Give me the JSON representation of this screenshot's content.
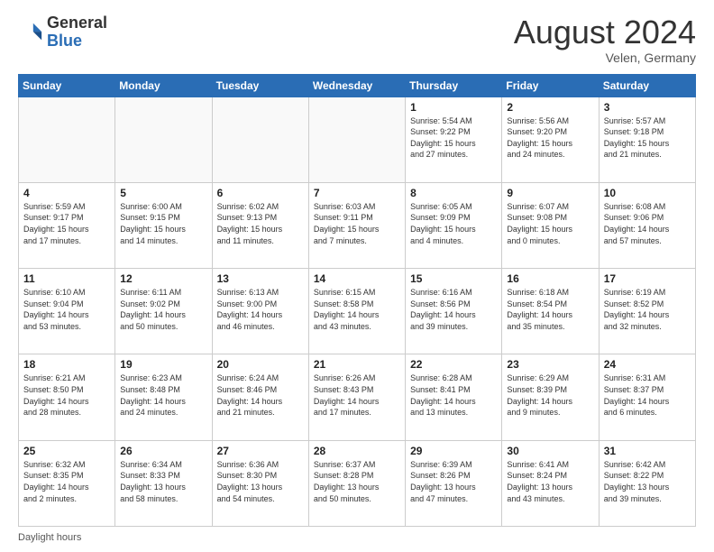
{
  "header": {
    "logo_general": "General",
    "logo_blue": "Blue",
    "month_title": "August 2024",
    "location": "Velen, Germany"
  },
  "footer": {
    "label": "Daylight hours"
  },
  "days_of_week": [
    "Sunday",
    "Monday",
    "Tuesday",
    "Wednesday",
    "Thursday",
    "Friday",
    "Saturday"
  ],
  "weeks": [
    [
      {
        "day": "",
        "info": ""
      },
      {
        "day": "",
        "info": ""
      },
      {
        "day": "",
        "info": ""
      },
      {
        "day": "",
        "info": ""
      },
      {
        "day": "1",
        "info": "Sunrise: 5:54 AM\nSunset: 9:22 PM\nDaylight: 15 hours\nand 27 minutes."
      },
      {
        "day": "2",
        "info": "Sunrise: 5:56 AM\nSunset: 9:20 PM\nDaylight: 15 hours\nand 24 minutes."
      },
      {
        "day": "3",
        "info": "Sunrise: 5:57 AM\nSunset: 9:18 PM\nDaylight: 15 hours\nand 21 minutes."
      }
    ],
    [
      {
        "day": "4",
        "info": "Sunrise: 5:59 AM\nSunset: 9:17 PM\nDaylight: 15 hours\nand 17 minutes."
      },
      {
        "day": "5",
        "info": "Sunrise: 6:00 AM\nSunset: 9:15 PM\nDaylight: 15 hours\nand 14 minutes."
      },
      {
        "day": "6",
        "info": "Sunrise: 6:02 AM\nSunset: 9:13 PM\nDaylight: 15 hours\nand 11 minutes."
      },
      {
        "day": "7",
        "info": "Sunrise: 6:03 AM\nSunset: 9:11 PM\nDaylight: 15 hours\nand 7 minutes."
      },
      {
        "day": "8",
        "info": "Sunrise: 6:05 AM\nSunset: 9:09 PM\nDaylight: 15 hours\nand 4 minutes."
      },
      {
        "day": "9",
        "info": "Sunrise: 6:07 AM\nSunset: 9:08 PM\nDaylight: 15 hours\nand 0 minutes."
      },
      {
        "day": "10",
        "info": "Sunrise: 6:08 AM\nSunset: 9:06 PM\nDaylight: 14 hours\nand 57 minutes."
      }
    ],
    [
      {
        "day": "11",
        "info": "Sunrise: 6:10 AM\nSunset: 9:04 PM\nDaylight: 14 hours\nand 53 minutes."
      },
      {
        "day": "12",
        "info": "Sunrise: 6:11 AM\nSunset: 9:02 PM\nDaylight: 14 hours\nand 50 minutes."
      },
      {
        "day": "13",
        "info": "Sunrise: 6:13 AM\nSunset: 9:00 PM\nDaylight: 14 hours\nand 46 minutes."
      },
      {
        "day": "14",
        "info": "Sunrise: 6:15 AM\nSunset: 8:58 PM\nDaylight: 14 hours\nand 43 minutes."
      },
      {
        "day": "15",
        "info": "Sunrise: 6:16 AM\nSunset: 8:56 PM\nDaylight: 14 hours\nand 39 minutes."
      },
      {
        "day": "16",
        "info": "Sunrise: 6:18 AM\nSunset: 8:54 PM\nDaylight: 14 hours\nand 35 minutes."
      },
      {
        "day": "17",
        "info": "Sunrise: 6:19 AM\nSunset: 8:52 PM\nDaylight: 14 hours\nand 32 minutes."
      }
    ],
    [
      {
        "day": "18",
        "info": "Sunrise: 6:21 AM\nSunset: 8:50 PM\nDaylight: 14 hours\nand 28 minutes."
      },
      {
        "day": "19",
        "info": "Sunrise: 6:23 AM\nSunset: 8:48 PM\nDaylight: 14 hours\nand 24 minutes."
      },
      {
        "day": "20",
        "info": "Sunrise: 6:24 AM\nSunset: 8:46 PM\nDaylight: 14 hours\nand 21 minutes."
      },
      {
        "day": "21",
        "info": "Sunrise: 6:26 AM\nSunset: 8:43 PM\nDaylight: 14 hours\nand 17 minutes."
      },
      {
        "day": "22",
        "info": "Sunrise: 6:28 AM\nSunset: 8:41 PM\nDaylight: 14 hours\nand 13 minutes."
      },
      {
        "day": "23",
        "info": "Sunrise: 6:29 AM\nSunset: 8:39 PM\nDaylight: 14 hours\nand 9 minutes."
      },
      {
        "day": "24",
        "info": "Sunrise: 6:31 AM\nSunset: 8:37 PM\nDaylight: 14 hours\nand 6 minutes."
      }
    ],
    [
      {
        "day": "25",
        "info": "Sunrise: 6:32 AM\nSunset: 8:35 PM\nDaylight: 14 hours\nand 2 minutes."
      },
      {
        "day": "26",
        "info": "Sunrise: 6:34 AM\nSunset: 8:33 PM\nDaylight: 13 hours\nand 58 minutes."
      },
      {
        "day": "27",
        "info": "Sunrise: 6:36 AM\nSunset: 8:30 PM\nDaylight: 13 hours\nand 54 minutes."
      },
      {
        "day": "28",
        "info": "Sunrise: 6:37 AM\nSunset: 8:28 PM\nDaylight: 13 hours\nand 50 minutes."
      },
      {
        "day": "29",
        "info": "Sunrise: 6:39 AM\nSunset: 8:26 PM\nDaylight: 13 hours\nand 47 minutes."
      },
      {
        "day": "30",
        "info": "Sunrise: 6:41 AM\nSunset: 8:24 PM\nDaylight: 13 hours\nand 43 minutes."
      },
      {
        "day": "31",
        "info": "Sunrise: 6:42 AM\nSunset: 8:22 PM\nDaylight: 13 hours\nand 39 minutes."
      }
    ]
  ]
}
